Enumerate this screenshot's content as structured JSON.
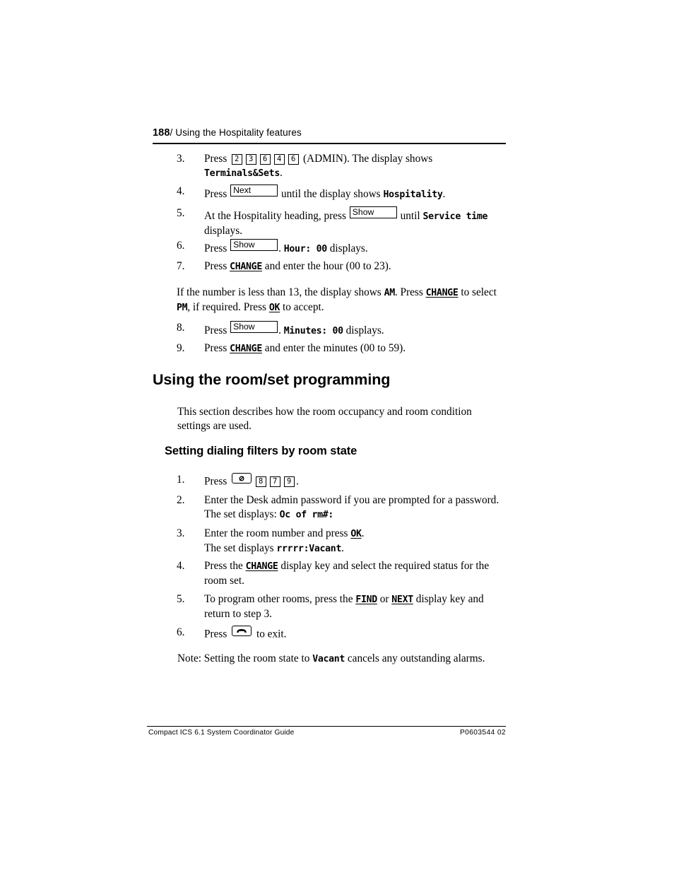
{
  "page": {
    "number": "188",
    "separator": "/",
    "header_title": "Using the Hospitality features"
  },
  "footer": {
    "guide": "Compact ICS 6.1  System Coordinator Guide",
    "doc_number": "P0603544   02"
  },
  "service_time_steps": {
    "step3": {
      "num": "3.",
      "press": "Press",
      "keys": [
        "2",
        "3",
        "6",
        "4",
        "6"
      ],
      "after_keys": "(ADMIN). The display shows",
      "display": "Terminals&Sets",
      "end": "."
    },
    "step4": {
      "num": "4.",
      "press": "Press",
      "key_label": "Next",
      "middle": "until the display shows",
      "display": "Hospitality",
      "end": "."
    },
    "step5": {
      "num": "5.",
      "lead": "At the Hospitality heading, press",
      "key_label": "Show",
      "middle": "until",
      "display": "Service time",
      "tail": "displays."
    },
    "step6": {
      "num": "6.",
      "press": "Press",
      "key_label": "Show",
      "dot": ".",
      "display": "Hour: 00",
      "tail": "displays."
    },
    "step7": {
      "num": "7.",
      "press": "Press",
      "display_key": "CHANGE",
      "tail": "and enter the hour (00 to 23)."
    },
    "note_ampm": {
      "lead": "If the number is less than 13, the display shows",
      "am": "AM",
      "mid1": ". Press",
      "change": "CHANGE",
      "mid2": "to select",
      "pm": "PM",
      "mid3": ", if required. Press",
      "ok": "OK",
      "tail": "to accept."
    },
    "step8": {
      "num": "8.",
      "press": "Press",
      "key_label": "Show",
      "dot": ".",
      "display": "Minutes: 00",
      "tail": "displays."
    },
    "step9": {
      "num": "9.",
      "press": "Press",
      "display_key": "CHANGE",
      "tail": "and enter the minutes (00 to 59)."
    }
  },
  "section": {
    "h1": "Using the room/set programming",
    "intro": "This section describes how the room occupancy and room condition settings are used.",
    "h2": "Setting dialing filters by room state"
  },
  "room_state_steps": {
    "step1": {
      "num": "1.",
      "press": "Press",
      "feature_key_icon": "feature-key-icon",
      "keys": [
        "8",
        "7",
        "9"
      ],
      "end": "."
    },
    "step2": {
      "num": "2.",
      "line1": "Enter the Desk admin password if you are prompted for a password.",
      "line2_lead": "The set displays:",
      "display": "Oc of rm#:",
      "line2_tail": ""
    },
    "step3": {
      "num": "3.",
      "line1_lead": "Enter the room number and press",
      "ok": "OK",
      "line1_tail": ".",
      "line2_lead": "The set displays",
      "display": "rrrrr:Vacant",
      "line2_tail": "."
    },
    "step4": {
      "num": "4.",
      "lead": "Press the",
      "display_key": "CHANGE",
      "tail": "display key and select the required status for the room set."
    },
    "step5": {
      "num": "5.",
      "lead": "To program other rooms, press the",
      "find": "FIND",
      "or": "or",
      "next": "NEXT",
      "tail": "display key and return to step 3."
    },
    "step6": {
      "num": "6.",
      "press": "Press",
      "release_key_icon": "release-handset-key-icon",
      "tail": "to exit."
    },
    "note": {
      "lead": "Note: Setting the room state to",
      "display": "Vacant",
      "tail": "cancels any outstanding alarms."
    }
  }
}
